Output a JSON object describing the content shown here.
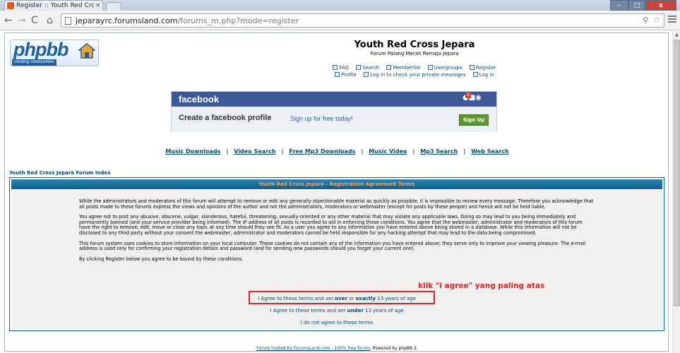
{
  "browser": {
    "tab_title": "Register :: Youth Red Cros",
    "tab_close": "×",
    "url_host": "jeparayrc.forumsland.com",
    "url_path": "/forums_m.php?mode=register",
    "window_controls": {
      "minimize": "–",
      "maximize": "□",
      "close": "x"
    },
    "nav_icons": {
      "back": "←",
      "forward": "→",
      "reload": "C",
      "home": "⌂"
    }
  },
  "logo": {
    "word": "phpbb",
    "tagline": "creating communities"
  },
  "header": {
    "title": "Youth Red Cross Jepara",
    "description": "Forum Palang Merah Remaja Jepara",
    "nav_row1": [
      "FAQ",
      "Search",
      "Memberlist",
      "Usergroups",
      "Register"
    ],
    "nav_row2": [
      "Profile",
      "Log in to check your private messages",
      "Log in"
    ]
  },
  "facebook_ad": {
    "logo": "facebook",
    "headline": "Create a facebook profile",
    "subtext": "Sign up for free today!",
    "button": "Sign Up",
    "badge": "2"
  },
  "sponsored_links": [
    "Music Downloads",
    "Video Search",
    "Free Mp3 Downloads",
    "Music Video",
    "Mp3 Search",
    "Web Search"
  ],
  "separator": "|",
  "breadcrumb": "Youth Red Cross Jepara Forum Index",
  "agreement": {
    "heading": "Youth Red Cross Jepara - Registration Agreement Terms",
    "paragraphs": [
      "While the administrators and moderators of this forum will attempt to remove or edit any generally objectionable material as quickly as possible, it is impossible to review every message. Therefore you acknowledge that all posts made to these forums express the views and opinions of the author and not the administrators, moderators or webmaster (except for posts by these people) and hence will not be held liable.",
      "You agree not to post any abusive, obscene, vulgar, slanderous, hateful, threatening, sexually-oriented or any other material that may violate any applicable laws. Doing so may lead to you being immediately and permanently banned (and your service provider being informed). The IP address of all posts is recorded to aid in enforcing these conditions. You agree that the webmaster, administrator and moderators of this forum have the right to remove, edit, move or close any topic at any time should they see fit. As a user you agree to any information you have entered above being stored in a database. While this information will not be disclosed to any third party without your consent the webmaster, administrator and moderators cannot be held responsible for any hacking attempt that may lead to the data being compromised.",
      "This forum system uses cookies to store information on your local computer. These cookies do not contain any of the information you have entered above; they serve only to improve your viewing pleasure. The e-mail address is used only for confirming your registration details and password (and for sending new passwords should you forget your current one).",
      "By clicking Register below you agree to be bound by these conditions."
    ],
    "agree_over": {
      "pre": "I Agree to these terms and am ",
      "b1": "over",
      "mid": " or ",
      "b2": "exactly",
      "post": " 13 years of age"
    },
    "agree_under": {
      "pre": "I Agree to these terms and am ",
      "b1": "under",
      "post": " 13 years of age"
    },
    "disagree": "I do not agree to these terms",
    "annotation": "klik \"i agree\" yang paling atas"
  },
  "footer": {
    "link": "Forum hosted by ForumsLand.com - 100% free forum",
    "text": ", Powered by phpBB 2."
  }
}
